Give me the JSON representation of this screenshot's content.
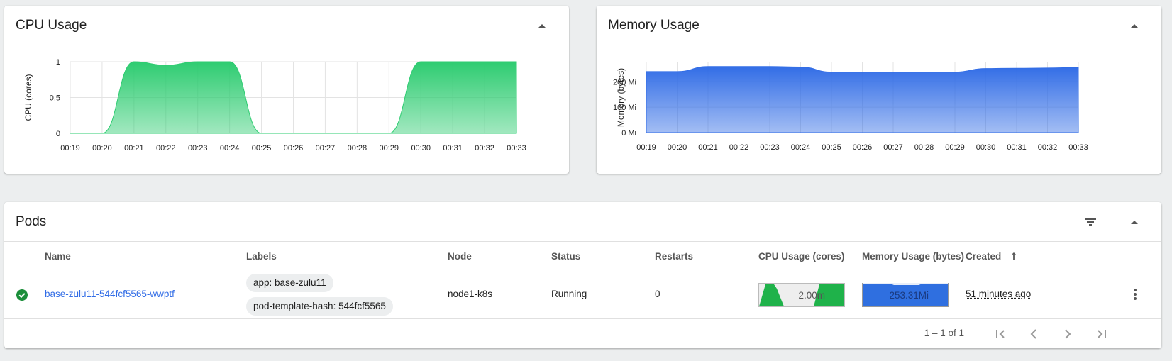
{
  "cpu_card": {
    "title": "CPU Usage",
    "chart_data": {
      "type": "area",
      "title": "",
      "xlabel": "",
      "ylabel": "CPU (cores)",
      "ylim": [
        0,
        1
      ],
      "yticks": [
        "0",
        "0.5",
        "1"
      ],
      "x": [
        "00:19",
        "00:20",
        "00:21",
        "00:22",
        "00:23",
        "00:24",
        "00:25",
        "00:26",
        "00:27",
        "00:28",
        "00:29",
        "00:30",
        "00:31",
        "00:32",
        "00:33"
      ],
      "series": [
        {
          "values": [
            0,
            0,
            1,
            0.95,
            1,
            1,
            0,
            0,
            0,
            0,
            0,
            1,
            1,
            1,
            1
          ]
        }
      ],
      "color": "#2ecc71",
      "grid": true
    }
  },
  "mem_card": {
    "title": "Memory Usage",
    "chart_data": {
      "type": "area",
      "title": "",
      "xlabel": "",
      "ylabel": "Memory (bytes)",
      "ylim": [
        0,
        276
      ],
      "yticks": [
        "0 Mi",
        "100 Mi",
        "200 Mi"
      ],
      "ytick_values": [
        0,
        100,
        200
      ],
      "x": [
        "00:19",
        "00:20",
        "00:21",
        "00:22",
        "00:23",
        "00:24",
        "00:25",
        "00:26",
        "00:27",
        "00:28",
        "00:29",
        "00:30",
        "00:31",
        "00:32",
        "00:33"
      ],
      "series": [
        {
          "values": [
            240,
            240,
            260,
            260,
            260,
            258,
            238,
            238,
            238,
            238,
            238,
            252,
            253,
            254,
            256
          ]
        }
      ],
      "color": "#326de6",
      "grid": true
    }
  },
  "pods_card": {
    "title": "Pods",
    "columns": {
      "name": "Name",
      "labels": "Labels",
      "node": "Node",
      "status": "Status",
      "restarts": "Restarts",
      "cpu": "CPU Usage (cores)",
      "memory": "Memory Usage (bytes)",
      "created": "Created"
    },
    "rows": [
      {
        "name": "base-zulu11-544fcf5565-wwptf",
        "labels": [
          "app: base-zulu11",
          "pod-template-hash: 544fcf5565"
        ],
        "node": "node1-k8s",
        "status": "Running",
        "restarts": "0",
        "cpu": "2.00m",
        "memory": "253.31Mi",
        "created": "51 minutes ago"
      }
    ],
    "pagination": {
      "range": "1 – 1 of 1"
    }
  },
  "icons": {
    "collapse": "chevron-up-icon",
    "filter": "filter-icon",
    "status": "check-circle-icon",
    "sort": "arrow-up-icon",
    "more": "more-vert-icon"
  }
}
